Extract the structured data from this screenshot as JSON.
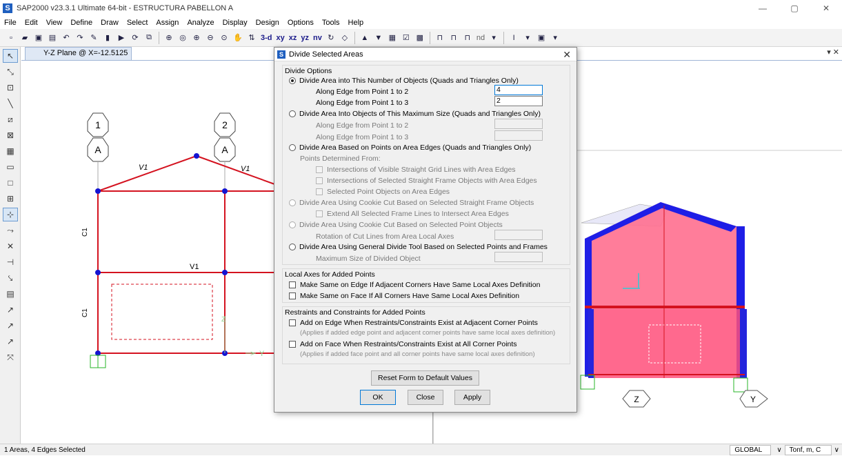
{
  "window": {
    "title": "SAP2000 v23.3.1 Ultimate 64-bit - ESTRUCTURA PABELLON A",
    "logo": "S",
    "minimize": "—",
    "maximize": "▢",
    "close": "✕"
  },
  "menu": [
    "File",
    "Edit",
    "View",
    "Define",
    "Draw",
    "Select",
    "Assign",
    "Analyze",
    "Display",
    "Design",
    "Options",
    "Tools",
    "Help"
  ],
  "toolbar": {
    "view_3d": "3-d",
    "view_xy": "xy",
    "view_xz": "xz",
    "view_yz": "yz",
    "view_nv": "nv",
    "nd": "nd"
  },
  "view_tab": {
    "label": "Y-Z Plane @ X=-12.5125",
    "close": "▾ ✕"
  },
  "plane_view": {
    "grid_bubbles": [
      "1",
      "2"
    ],
    "grid_letters": [
      "A",
      "A"
    ],
    "labels": {
      "v1a": "V1",
      "v1b": "V1",
      "v1c": "V1",
      "c1a": "C1",
      "c1b": "C1",
      "axis_z": "Z",
      "axis_y": "Y"
    }
  },
  "view3d": {
    "bubble_1": "Z",
    "bubble_2": "Y"
  },
  "dialog": {
    "logo": "S",
    "title": "Divide Selected Areas",
    "close": "✕",
    "divide_options": {
      "title": "Divide Options",
      "opt1": "Divide Area into This Number of Objects   (Quads and Triangles Only)",
      "opt1_edge12": "Along Edge from Point 1 to 2",
      "opt1_edge12_value": "4",
      "opt1_edge13": "Along Edge from Point 1 to 3",
      "opt1_edge13_value": "2",
      "opt2": "Divide Area Into Objects of This Maximum Size   (Quads and Triangles Only)",
      "opt2_edge12": "Along Edge from Point 1 to 2",
      "opt2_edge13": "Along Edge from Point 1 to 3",
      "opt3": "Divide Area Based on Points on Area Edges   (Quads and Triangles Only)",
      "opt3_points": "Points Determined From:",
      "opt3_check1": "Intersections of Visible Straight Grid Lines with Area Edges",
      "opt3_check2": "Intersections of Selected Straight Frame Objects with Area Edges",
      "opt3_check3": "Selected Point Objects on Area Edges",
      "opt4": "Divide Area Using Cookie Cut Based on Selected Straight Frame Objects",
      "opt4_check": "Extend All Selected Frame Lines to Intersect Area Edges",
      "opt5": "Divide Area Using Cookie Cut Based on Selected Point Objects",
      "opt5_rotation": "Rotation of Cut Lines from Area Local Axes",
      "opt6": "Divide Area Using General Divide Tool Based on Selected Points and Frames",
      "opt6_max": "Maximum Size of Divided Object"
    },
    "local_axes": {
      "title": "Local Axes for Added Points",
      "check1": "Make Same on Edge If Adjacent Corners Have Same Local Axes Definition",
      "check2": "Make Same on Face If All Corners Have Same Local Axes Definition"
    },
    "restraints": {
      "title": "Restraints and Constraints for Added Points",
      "check1": "Add on Edge When Restraints/Constraints Exist at Adjacent Corner Points",
      "note1": "(Applies if added edge point and adjacent corner points have same local axes definition)",
      "check2": "Add on Face When Restraints/Constraints Exist at All Corner Points",
      "note2": "(Applies if added face point and all corner points have same local axes definition)"
    },
    "buttons": {
      "reset": "Reset Form to Default Values",
      "ok": "OK",
      "close": "Close",
      "apply": "Apply"
    }
  },
  "status": {
    "selection": "1 Areas, 4 Edges Selected",
    "coord_system": "GLOBAL",
    "units": "Tonf, m, C"
  },
  "colors": {
    "frame_red": "#d4121f",
    "node_blue": "#1414d2",
    "area_pink": "#ff6f8f",
    "frame3d_blue": "#1e1ee6"
  }
}
